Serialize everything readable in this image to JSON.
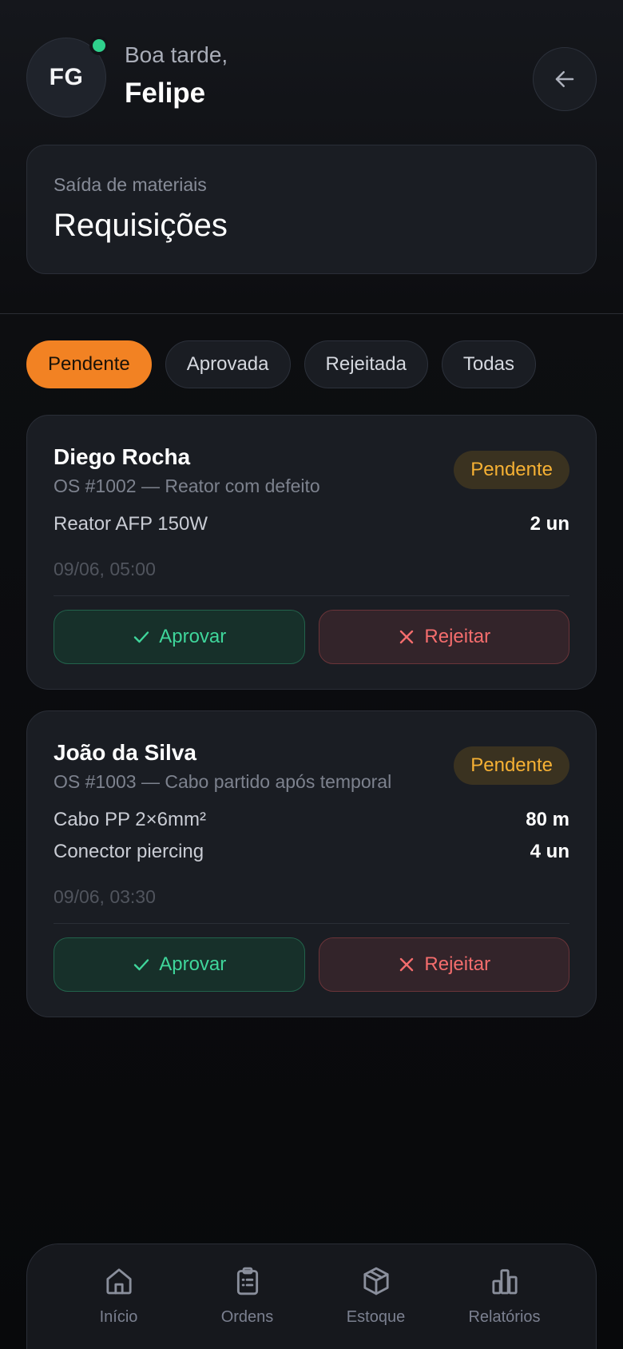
{
  "header": {
    "avatar_initials": "FG",
    "greeting": "Boa tarde,",
    "user_name": "Felipe"
  },
  "title_card": {
    "subtitle": "Saída de materiais",
    "title": "Requisições"
  },
  "filters": [
    {
      "label": "Pendente",
      "active": true
    },
    {
      "label": "Aprovada",
      "active": false
    },
    {
      "label": "Rejeitada",
      "active": false
    },
    {
      "label": "Todas",
      "active": false
    }
  ],
  "requests": [
    {
      "name": "Diego Rocha",
      "os": "OS #1002 — Reator com defeito",
      "status": "Pendente",
      "items": [
        {
          "name": "Reator AFP 150W",
          "qty": "2 un"
        }
      ],
      "date": "09/06, 05:00",
      "approve_label": "Aprovar",
      "reject_label": "Rejeitar"
    },
    {
      "name": "João da Silva",
      "os": "OS #1003 — Cabo partido após temporal",
      "status": "Pendente",
      "items": [
        {
          "name": "Cabo PP 2×6mm²",
          "qty": "80 m"
        },
        {
          "name": "Conector piercing",
          "qty": "4 un"
        }
      ],
      "date": "09/06, 03:30",
      "approve_label": "Aprovar",
      "reject_label": "Rejeitar"
    }
  ],
  "nav": [
    {
      "label": "Início",
      "icon": "home-icon"
    },
    {
      "label": "Ordens",
      "icon": "clipboard-icon"
    },
    {
      "label": "Estoque",
      "icon": "box-icon"
    },
    {
      "label": "Relatórios",
      "icon": "bar-chart-icon"
    }
  ],
  "colors": {
    "accent": "#f28223",
    "online": "#2fd08c",
    "approve": "#3fd69b",
    "reject": "#f46d6d",
    "pending": "#f6b134"
  }
}
